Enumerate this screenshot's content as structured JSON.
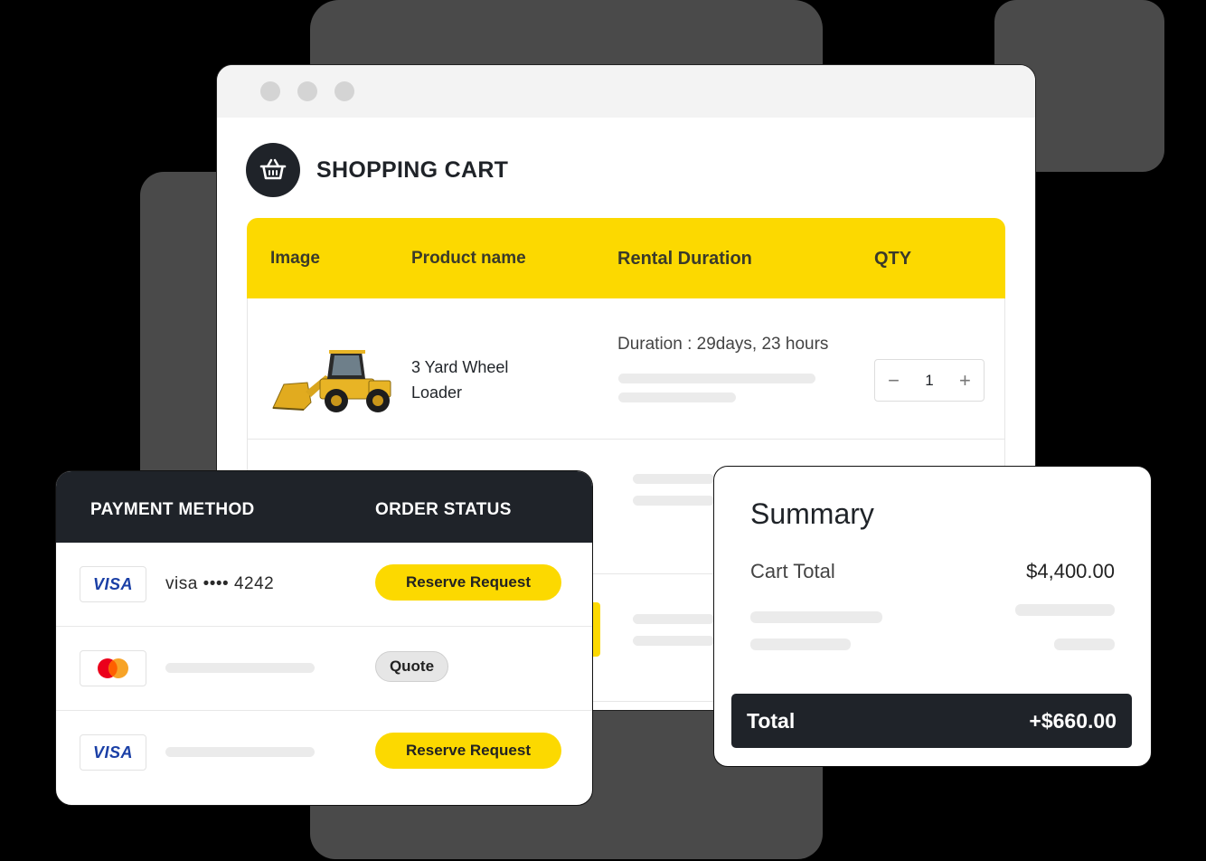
{
  "cart": {
    "title": "SHOPPING CART",
    "columns": [
      "Image",
      "Product name",
      "Rental Duration",
      "QTY"
    ],
    "item": {
      "name": "3 Yard Wheel Loader",
      "duration": "Duration : 29days, 23 hours",
      "qty": "1",
      "minus": "−",
      "plus": "+"
    }
  },
  "payment": {
    "headers": {
      "method": "PAYMENT METHOD",
      "status": "ORDER STATUS"
    },
    "rows": [
      {
        "brand": "VISA",
        "number": "visa •••• 4242",
        "status": "Reserve Request"
      },
      {
        "brand": "mastercard",
        "number": "",
        "status": "Quote"
      },
      {
        "brand": "VISA",
        "number": "",
        "status": "Reserve Request"
      }
    ]
  },
  "summary": {
    "title": "Summary",
    "cart_total_label": "Cart Total",
    "cart_total_value": "$4,400.00",
    "total_label": "Total",
    "total_value": "+$660.00"
  },
  "colors": {
    "accent": "#fcd900",
    "dark": "#1f2329",
    "backdrop": "#4a4a4a"
  }
}
